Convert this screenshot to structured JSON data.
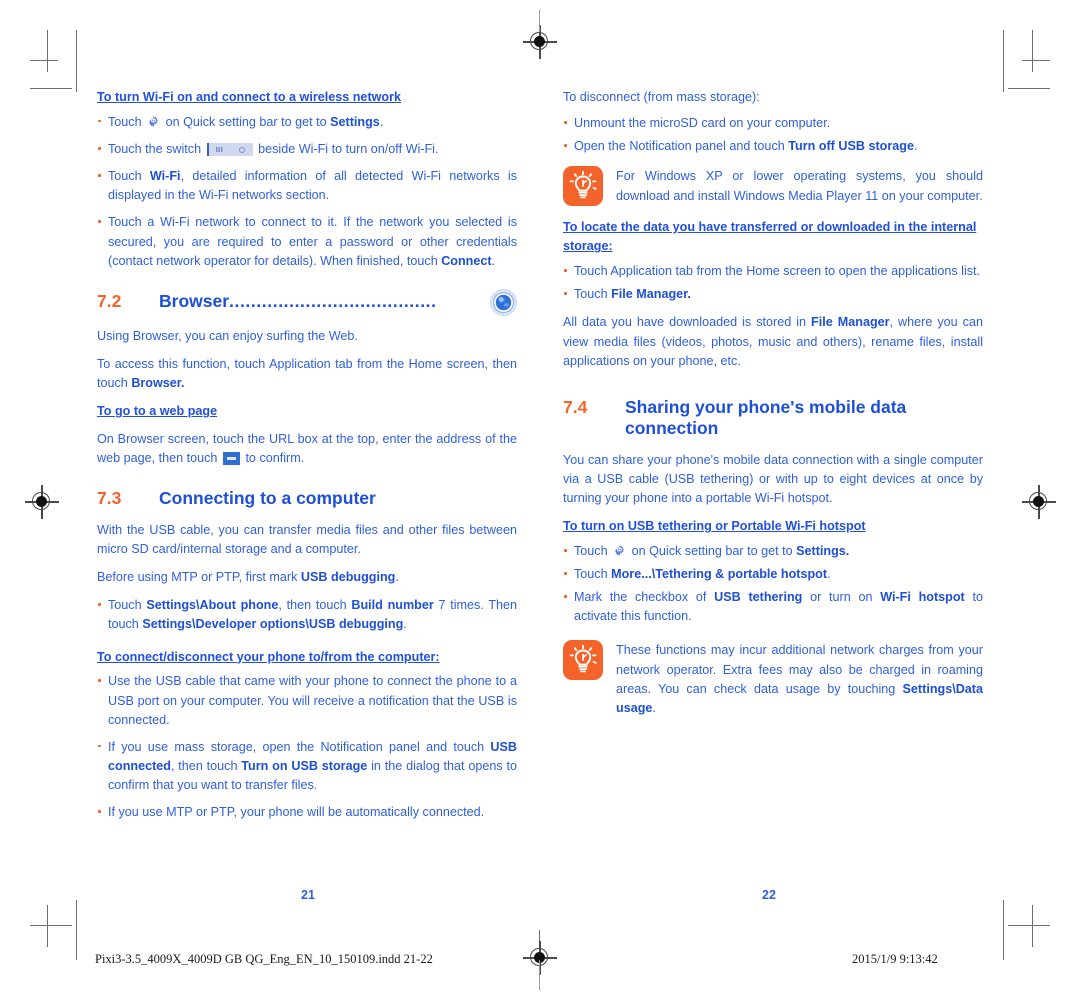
{
  "document": {
    "footer_file": "Pixi3-3.5_4009X_4009D GB QG_Eng_EN_10_150109.indd   21-22",
    "footer_timestamp": "2015/1/9   9:13:42",
    "page_number_left": "21",
    "page_number_right": "22",
    "colors": {
      "body_blue": "#2f5fe0",
      "heading_blue": "#1d4fd8",
      "accent_orange": "#f4642a",
      "bullet_orange": "#e8622a"
    }
  },
  "left_page": {
    "wifi_heading": "To turn Wi-Fi on and connect to a wireless network",
    "wifi_bullets": {
      "b1_pre": "Touch",
      "b1_mid": "on Quick setting bar to get to",
      "b1_bold": "Settings",
      "b1_end": ".",
      "b2_pre": "Touch the switch",
      "b2_end": "beside Wi-Fi to  turn on/off Wi-Fi.",
      "b3_pre": "Touch",
      "b3_bold": "Wi-Fi",
      "b3_end": ", detailed information of all detected Wi-Fi networks is displayed in the Wi-Fi networks section.",
      "b4_pre": "Touch a Wi-Fi network to connect to it. If the network you selected is secured, you are required to enter a password or other credentials (contact network operator for details). When finished, touch",
      "b4_bold": "Connect",
      "b4_end": "."
    },
    "section_72": {
      "number": "7.2",
      "title": "Browser",
      "dots": "......................................",
      "icon": "browser-globe-icon"
    },
    "browser_p1": "Using Browser, you can enjoy surfing the Web.",
    "browser_p2_pre": "To access this function, touch Application tab from the Home screen, then touch",
    "browser_p2_bold": "Browser.",
    "webpage_heading": "To go to a web page",
    "webpage_p_pre": "On Browser screen, touch the URL box at the top, enter the address of the web page, then touch",
    "webpage_p_end": "to confirm.",
    "section_73": {
      "number": "7.3",
      "title": "Connecting to a computer"
    },
    "computer_p1": "With the USB cable, you can transfer media files and other files between micro SD card/internal storage and a computer.",
    "computer_p2_pre": "Before using MTP or PTP, first mark",
    "computer_p2_bold": "USB debugging",
    "computer_p2_end": ".",
    "computer_bullet": {
      "pre": "Touch",
      "b1": "Settings\\About phone",
      "mid": ", then touch",
      "b2": "Build number",
      "mid2": "7 times. Then touch",
      "b3": "Settings\\Developer options\\USB debugging",
      "end": "."
    },
    "connect_heading": "To connect/disconnect your phone to/from the computer:",
    "connect_bullets": {
      "b1": "Use the USB cable that came with your phone to connect the phone to a USB port on your computer. You will receive a notification that the USB is connected.",
      "b2_pre": "If you use mass storage, open the Notification panel and touch",
      "b2_bold1": "USB connected",
      "b2_mid": ", then touch",
      "b2_bold2": "Turn on USB storage",
      "b2_end": "in the dialog that opens to confirm that you want to transfer files.",
      "b3": "If you use MTP or PTP, your phone will be automatically connected."
    }
  },
  "right_page": {
    "disconnect_p": "To disconnect (from mass storage):",
    "disconnect_bullets": {
      "b1": "Unmount the microSD card on your computer.",
      "b2_pre": "Open the Notification panel and touch",
      "b2_bold": "Turn off USB storage",
      "b2_end": "."
    },
    "tip1": "For Windows XP or lower operating systems, you should download and install Windows Media Player 11 on your computer.",
    "locate_heading": "To locate the data you have transferred or downloaded in the internal storage:",
    "locate_bullets": {
      "b1": "Touch Application tab from the Home screen to open the applications list.",
      "b2_pre": "Touch",
      "b2_bold": "File Manager."
    },
    "locate_p_pre": "All data you have downloaded is stored in",
    "locate_p_bold": "File Manager",
    "locate_p_end": ", where you can view media files (videos, photos, music and others), rename files, install applications on your phone, etc.",
    "section_74": {
      "number": "7.4",
      "title_line1": "Sharing your phone's mobile data",
      "title_line2": "connection"
    },
    "sharing_p": "You can share your phone's mobile data connection with a single computer via a USB cable (USB tethering) or with up to eight devices at once by turning your phone into a portable Wi-Fi hotspot.",
    "tether_heading": "To turn on USB tethering or Portable Wi-Fi hotspot",
    "tether_bullets": {
      "b1_pre": "Touch",
      "b1_mid": "on Quick setting bar to get to",
      "b1_bold": "Settings.",
      "b2_pre": "Touch",
      "b2_bold": "More...\\Tethering & portable hotspot",
      "b2_end": ".",
      "b3_pre": "Mark the checkbox of",
      "b3_bold1": "USB tethering",
      "b3_mid": "or turn on",
      "b3_bold2": "Wi-Fi hotspot",
      "b3_end": "to activate this function."
    },
    "tip2_pre": "These functions may incur additional network charges from your network operator. Extra fees may also be charged in roaming areas. You can check data usage by touching",
    "tip2_bold": "Settings\\Data usage",
    "tip2_end": "."
  }
}
